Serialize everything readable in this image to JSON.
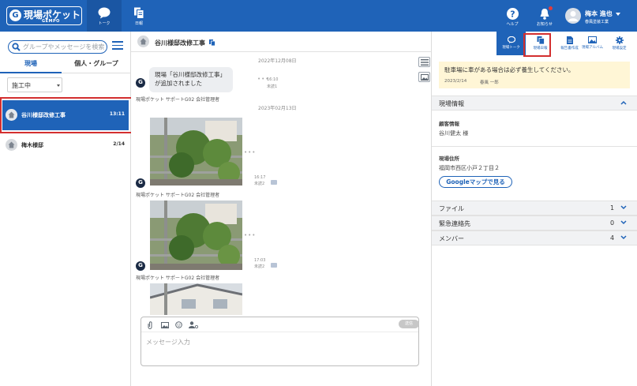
{
  "header": {
    "logo_title": "現場ポケット",
    "logo_sub": "GEMPO",
    "logo_mark": "G",
    "nav": [
      {
        "label": "トーク",
        "icon": "chat-bubble-icon"
      },
      {
        "label": "日報",
        "icon": "daily-report-icon"
      }
    ],
    "help_label": "ヘルプ",
    "notice_label": "お知らせ",
    "user_name": "梅本 進也",
    "user_company": "春風塗装工業"
  },
  "sidebar": {
    "search_placeholder": "グループやメッセージを検索",
    "tabs": [
      "現場",
      "個人・グループ"
    ],
    "filter_value": "施工中",
    "rooms": [
      {
        "name": "谷川様邸改修工事",
        "time": "13:11"
      },
      {
        "name": "梅木様邸",
        "time": "2/14"
      }
    ]
  },
  "chat": {
    "title": "谷川様邸改修工事",
    "messages": [
      {
        "date": "2022年12月08日",
        "text": "現場「谷川様邸改修工事」が追加されました",
        "time": "16:10",
        "read": "未読1",
        "sender": "現場ポケット サポートG02 会社管理者"
      },
      {
        "date": "2023年02月13日",
        "time": "16:17",
        "read": "未読2",
        "sender": "現場ポケット サポートG02 会社管理者"
      },
      {
        "time": "17:03",
        "read": "未読2",
        "sender": "現場ポケット サポートG02 会社管理者"
      }
    ],
    "send_label": "送信",
    "input_placeholder": "メッセージ入力"
  },
  "panel": {
    "tabs": [
      "現場トーク",
      "現場日報",
      "報告書作成",
      "現場アルバム",
      "現場設定"
    ],
    "notice_text": "駐車場に車がある場合は必ず養生してください。",
    "notice_date": "2023/2/14",
    "notice_author": "春風 一郎",
    "site_info_title": "現場情報",
    "client_label": "顧客情報",
    "client_value": "谷川健太 様",
    "address_label": "現場住所",
    "address_value": "福岡市西区小戸２丁目２",
    "map_button": "Googleマップで見る",
    "sections": [
      {
        "label": "ファイル",
        "count": "1"
      },
      {
        "label": "緊急連絡先",
        "count": "0"
      },
      {
        "label": "メンバー",
        "count": "4"
      }
    ]
  },
  "colors": {
    "brand": "#1f63b8",
    "highlight": "#d32f2f",
    "notice_bg": "#fff6d6"
  }
}
